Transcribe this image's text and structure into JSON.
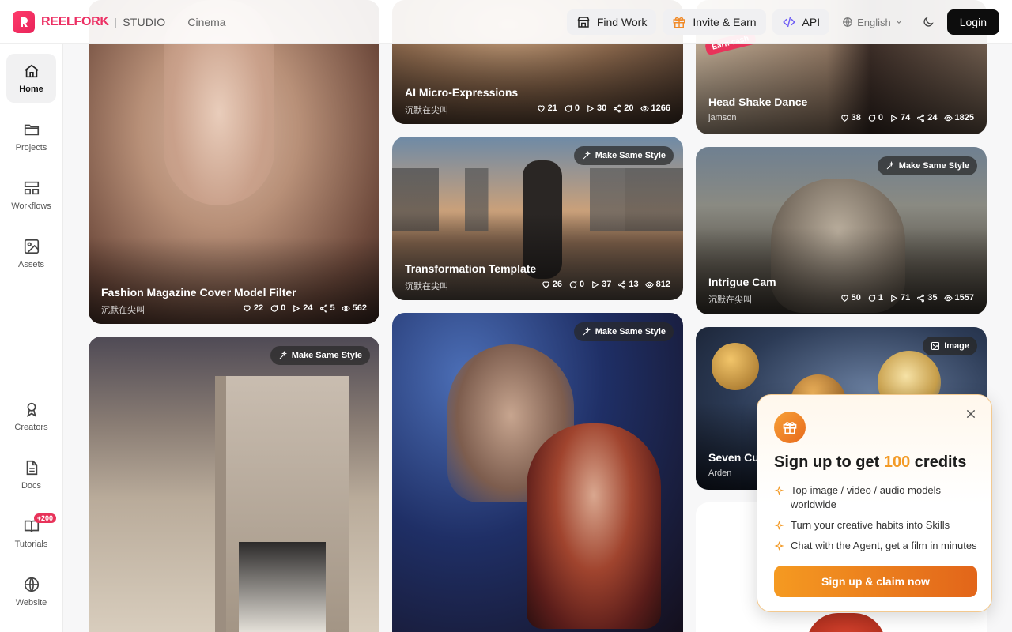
{
  "brand": {
    "name": "REELFORK",
    "separator": "|",
    "product": "STUDIO"
  },
  "nav": {
    "cinema": "Cinema"
  },
  "top_actions": {
    "find_work": "Find Work",
    "invite_earn": "Invite & Earn",
    "api": "API",
    "language": "English",
    "login": "Login"
  },
  "sidebar": {
    "items": [
      {
        "label": "Home",
        "icon": "home-icon"
      },
      {
        "label": "Projects",
        "icon": "folder-icon"
      },
      {
        "label": "Workflows",
        "icon": "workflow-icon"
      },
      {
        "label": "Assets",
        "icon": "image-icon"
      },
      {
        "label": "Creators",
        "icon": "award-icon"
      },
      {
        "label": "Docs",
        "icon": "document-icon"
      },
      {
        "label": "Tutorials",
        "icon": "book-icon",
        "badge": "+200"
      },
      {
        "label": "Website",
        "icon": "globe-icon"
      }
    ]
  },
  "cards": [
    {
      "title": "Fashion Magazine Cover Model Filter",
      "author": "沉默在尖叫",
      "likes": "22",
      "comments": "0",
      "plays": "24",
      "shares": "5",
      "views": "562"
    },
    {
      "title": "AI Micro-Expressions",
      "author": "沉默在尖叫",
      "likes": "21",
      "comments": "0",
      "plays": "30",
      "shares": "20",
      "views": "1266"
    },
    {
      "title": "Head Shake Dance",
      "author": "jamson",
      "likes": "38",
      "comments": "0",
      "plays": "74",
      "shares": "24",
      "views": "1825",
      "ribbon": "Earn cash"
    },
    {
      "title": "Transformation Template",
      "author": "沉默在尖叫",
      "likes": "26",
      "comments": "0",
      "plays": "37",
      "shares": "13",
      "views": "812",
      "badge": "Make Same Style"
    },
    {
      "title": "Intrigue Cam",
      "author": "沉默在尖叫",
      "likes": "50",
      "comments": "1",
      "plays": "71",
      "shares": "35",
      "views": "1557",
      "badge": "Make Same Style"
    },
    {
      "badge": "Make Same Style"
    },
    {
      "badge": "Make Same Style"
    },
    {
      "title": "Seven Cu",
      "author": "Arden",
      "badge": "Image"
    }
  ],
  "promo": {
    "title_prefix": "Sign up to get ",
    "title_amount": "100",
    "title_suffix": " credits",
    "items": [
      "Top image / video / audio models worldwide",
      "Turn your creative habits into Skills",
      "Chat with the Agent, get a film in minutes"
    ],
    "cta": "Sign up & claim now"
  },
  "colors": {
    "brand": "#ec2f63",
    "promo_accent": "#f39a26",
    "login_bg": "#0d0d0d"
  }
}
